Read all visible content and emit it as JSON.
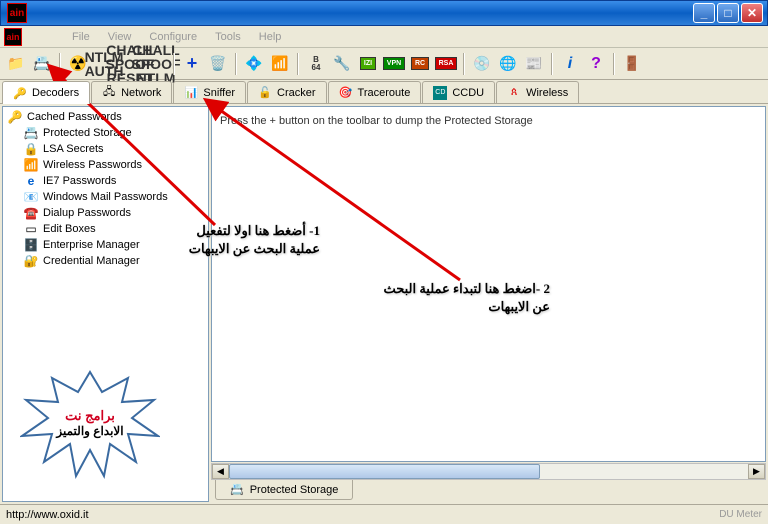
{
  "window": {
    "app_icon_text": "ain"
  },
  "menu": {
    "file": "File",
    "view": "View",
    "configure": "Configure",
    "tools": "Tools",
    "help": "Help"
  },
  "toolbar": {
    "ntlm_auth": "NTLM\nAUTH",
    "chall_reset": "CHALL\nSPOOF\nRESET",
    "chall_ntlm": "CHALL\nSPOOF\nNTLM",
    "b64": "B\n64"
  },
  "tabs": {
    "decoders": "Decoders",
    "network": "Network",
    "sniffer": "Sniffer",
    "cracker": "Cracker",
    "traceroute": "Traceroute",
    "ccdu": "CCDU",
    "wireless": "Wireless"
  },
  "tree": {
    "root": "Cached Passwords",
    "items": [
      "Protected Storage",
      "LSA Secrets",
      "Wireless Passwords",
      "IE7 Passwords",
      "Windows Mail Passwords",
      "Dialup Passwords",
      "Edit Boxes",
      "Enterprise Manager",
      "Credential Manager"
    ]
  },
  "content": {
    "hint": "Press the + button on the toolbar to dump the Protected Storage"
  },
  "bottom_tab": "Protected Storage",
  "status": {
    "url": "http://www.oxid.it",
    "right": "DU Meter"
  },
  "annotations": {
    "a1": "1- أضغط هنا اولا لتفعيل عملية البحث عن الايبهات",
    "a2": "2 -اضغط هنا لتبداء عملية البحث عن الايبهات"
  },
  "starburst": {
    "l1": "برامج نت",
    "l2": "الابداع والتميز"
  }
}
